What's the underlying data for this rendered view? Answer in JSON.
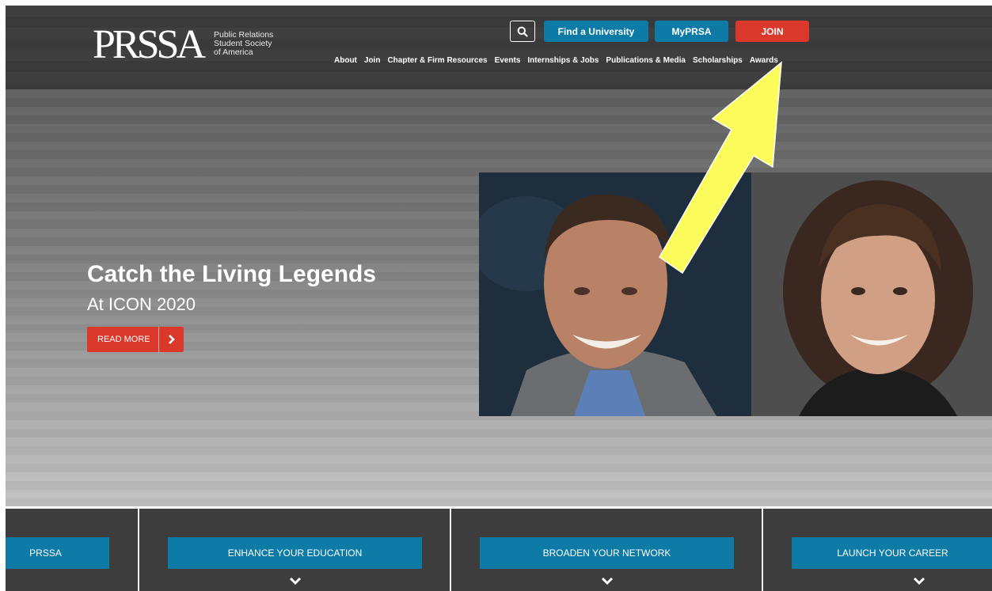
{
  "header": {
    "logo_mark": "PRSSA",
    "logo_lines": [
      "Public Relations",
      "Student Society",
      "of America"
    ],
    "find_university": "Find a University",
    "myprsa": "MyPRSA",
    "join": "JOIN",
    "nav": [
      "About",
      "Join",
      "Chapter & Firm Resources",
      "Events",
      "Internships & Jobs",
      "Publications & Media",
      "Scholarships",
      "Awards"
    ]
  },
  "hero": {
    "title": "Catch the Living Legends",
    "subtitle": "At ICON 2020",
    "read_more": "READ MORE"
  },
  "bottom": {
    "items": [
      "PRSSA",
      "ENHANCE YOUR EDUCATION",
      "BROADEN YOUR NETWORK",
      "LAUNCH YOUR CAREER"
    ]
  },
  "colors": {
    "accent_blue": "#0d7ba6",
    "join_red": "#d9382a",
    "header_bg": "#3d3d3d",
    "annotation_arrow": "#fbfb5b"
  },
  "icons": [
    "search-icon",
    "chevron-right-icon",
    "chevron-down-icon",
    "annotation-arrow"
  ]
}
